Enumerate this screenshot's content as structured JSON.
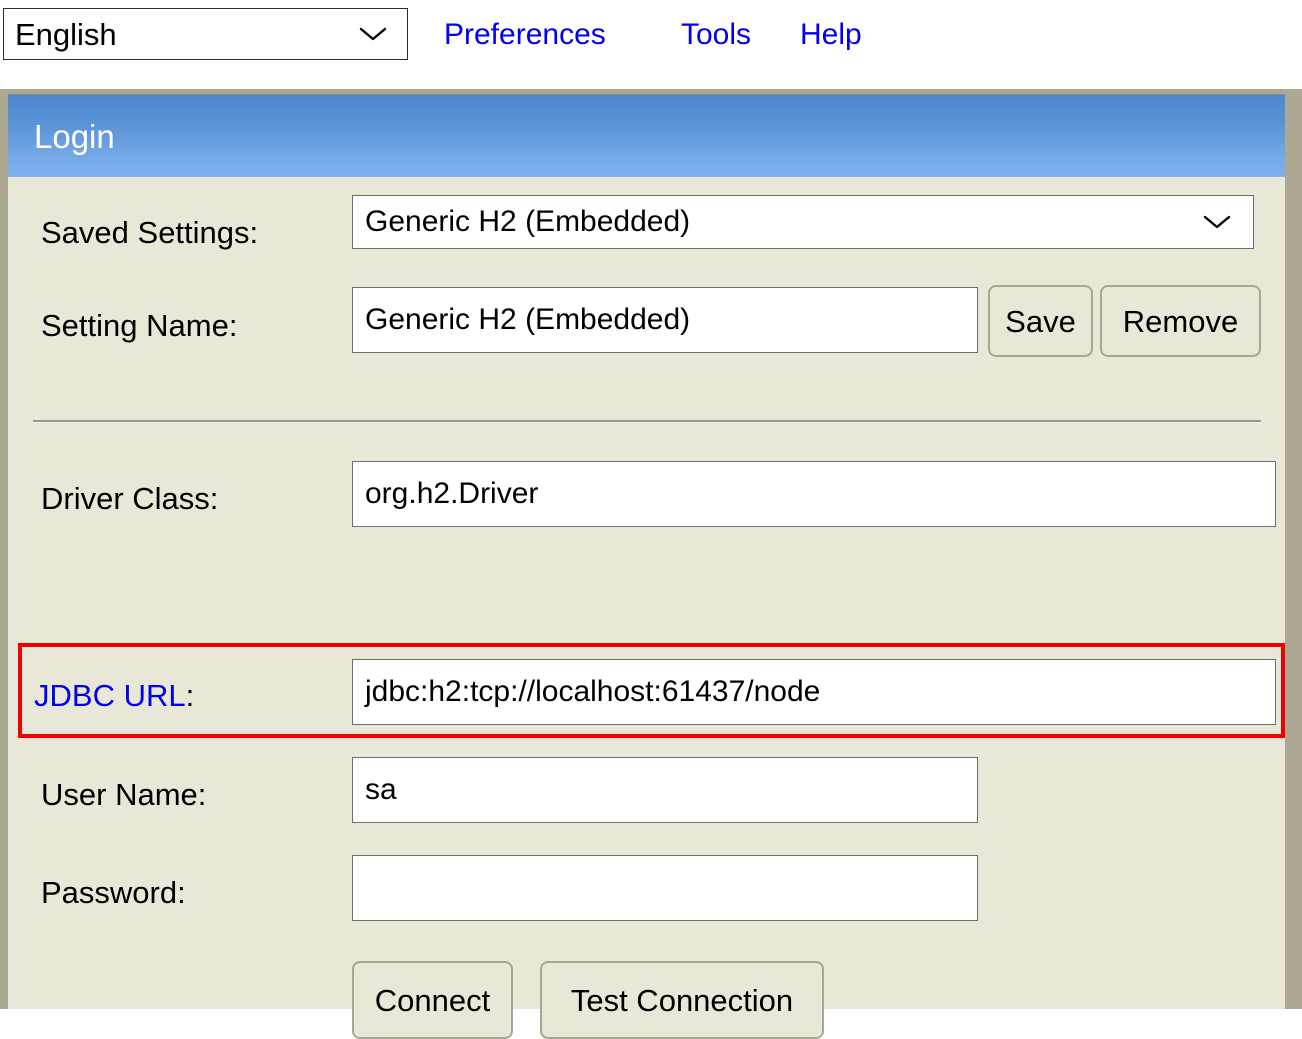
{
  "topbar": {
    "language_select": {
      "value": "English",
      "icon": "chevron-down-icon"
    },
    "menu": [
      {
        "label": "Preferences",
        "name": "preferences"
      },
      {
        "label": "Tools",
        "name": "tools"
      },
      {
        "label": "Help",
        "name": "help"
      }
    ]
  },
  "dialog": {
    "title": "Login",
    "accent_color": "#5a92d6",
    "panel_color": "#e9e7d8",
    "highlight_color": "#f00000",
    "link_color": "#0000ee",
    "fields": {
      "saved_settings": {
        "label": "Saved Settings:",
        "value": "Generic H2 (Embedded)",
        "icon": "chevron-down-icon"
      },
      "setting_name": {
        "label": "Setting Name:",
        "value": "Generic H2 (Embedded)"
      },
      "driver_class": {
        "label": "Driver Class:",
        "value": "org.h2.Driver"
      },
      "jdbc_url": {
        "label": "JDBC URL",
        "label_colon": ":",
        "value": "jdbc:h2:tcp://localhost:61437/node",
        "highlighted": true
      },
      "user_name": {
        "label": "User Name:",
        "value": "sa"
      },
      "password": {
        "label": "Password:",
        "value": ""
      }
    },
    "buttons": {
      "save": "Save",
      "remove": "Remove",
      "connect": "Connect",
      "test_connection": "Test Connection"
    }
  }
}
